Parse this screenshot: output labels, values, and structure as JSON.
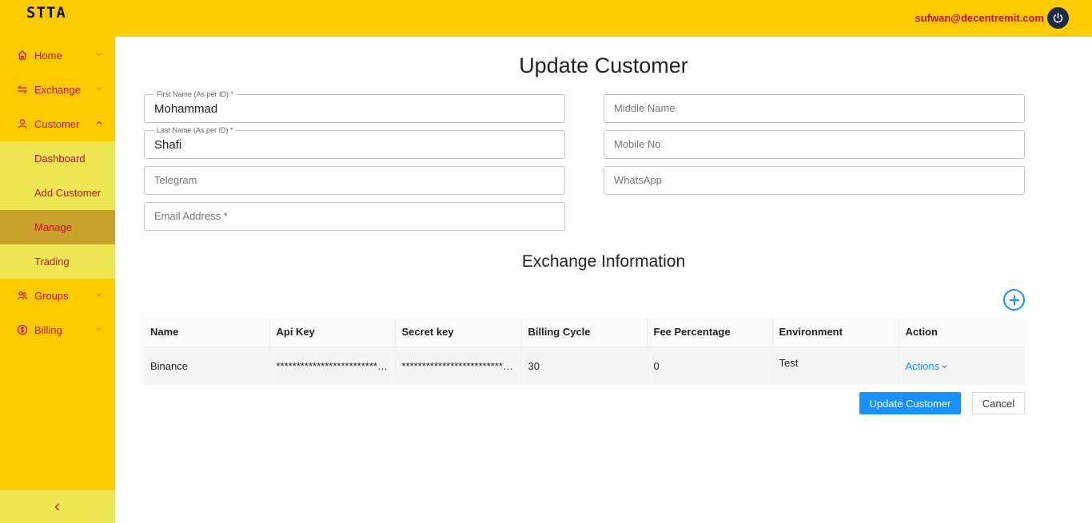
{
  "app": {
    "logo": "STTA",
    "user_email": "sufwan@decentremit.com"
  },
  "sidebar": {
    "items": [
      {
        "label": "Home",
        "icon": "home-icon"
      },
      {
        "label": "Exchange",
        "icon": "swap-icon"
      },
      {
        "label": "Customer",
        "icon": "user-icon"
      },
      {
        "label": "Groups",
        "icon": "group-icon"
      },
      {
        "label": "Billing",
        "icon": "billing-icon"
      }
    ],
    "customer_sub": [
      "Dashboard",
      "Add Customer",
      "Manage",
      "Trading"
    ],
    "active_sub": "Manage"
  },
  "page": {
    "title": "Update Customer"
  },
  "form": {
    "first_name": {
      "label": "First Name (As per ID) *",
      "value": "Mohammad"
    },
    "last_name": {
      "label": "Last Name (As per ID) *",
      "value": "Shafi"
    },
    "middle_name": {
      "placeholder": "Middle Name"
    },
    "mobile_no": {
      "placeholder": "Mobile No"
    },
    "telegram": {
      "placeholder": "Telegram"
    },
    "whatsapp": {
      "placeholder": "WhatsApp"
    },
    "email": {
      "placeholder": "Email Address *"
    }
  },
  "exchange": {
    "title": "Exchange Information",
    "columns": [
      "Name",
      "Api Key",
      "Secret key",
      "Billing Cycle",
      "Fee Percentage",
      "Environment",
      "Action"
    ],
    "rows": [
      {
        "name": "Binance",
        "api_key": "****************************************",
        "secret_key": "****************************************",
        "billing_cycle": "30",
        "fee_percentage": "0",
        "environment": "Test",
        "action": "Actions"
      }
    ]
  },
  "buttons": {
    "update": "Update Customer",
    "cancel": "Cancel"
  },
  "colors": {
    "brand_yellow": "#ffcc00",
    "sub_menu": "#eee752",
    "active_sub": "#c8a22a",
    "nav_text": "#c8102e",
    "primary": "#1890ff"
  }
}
